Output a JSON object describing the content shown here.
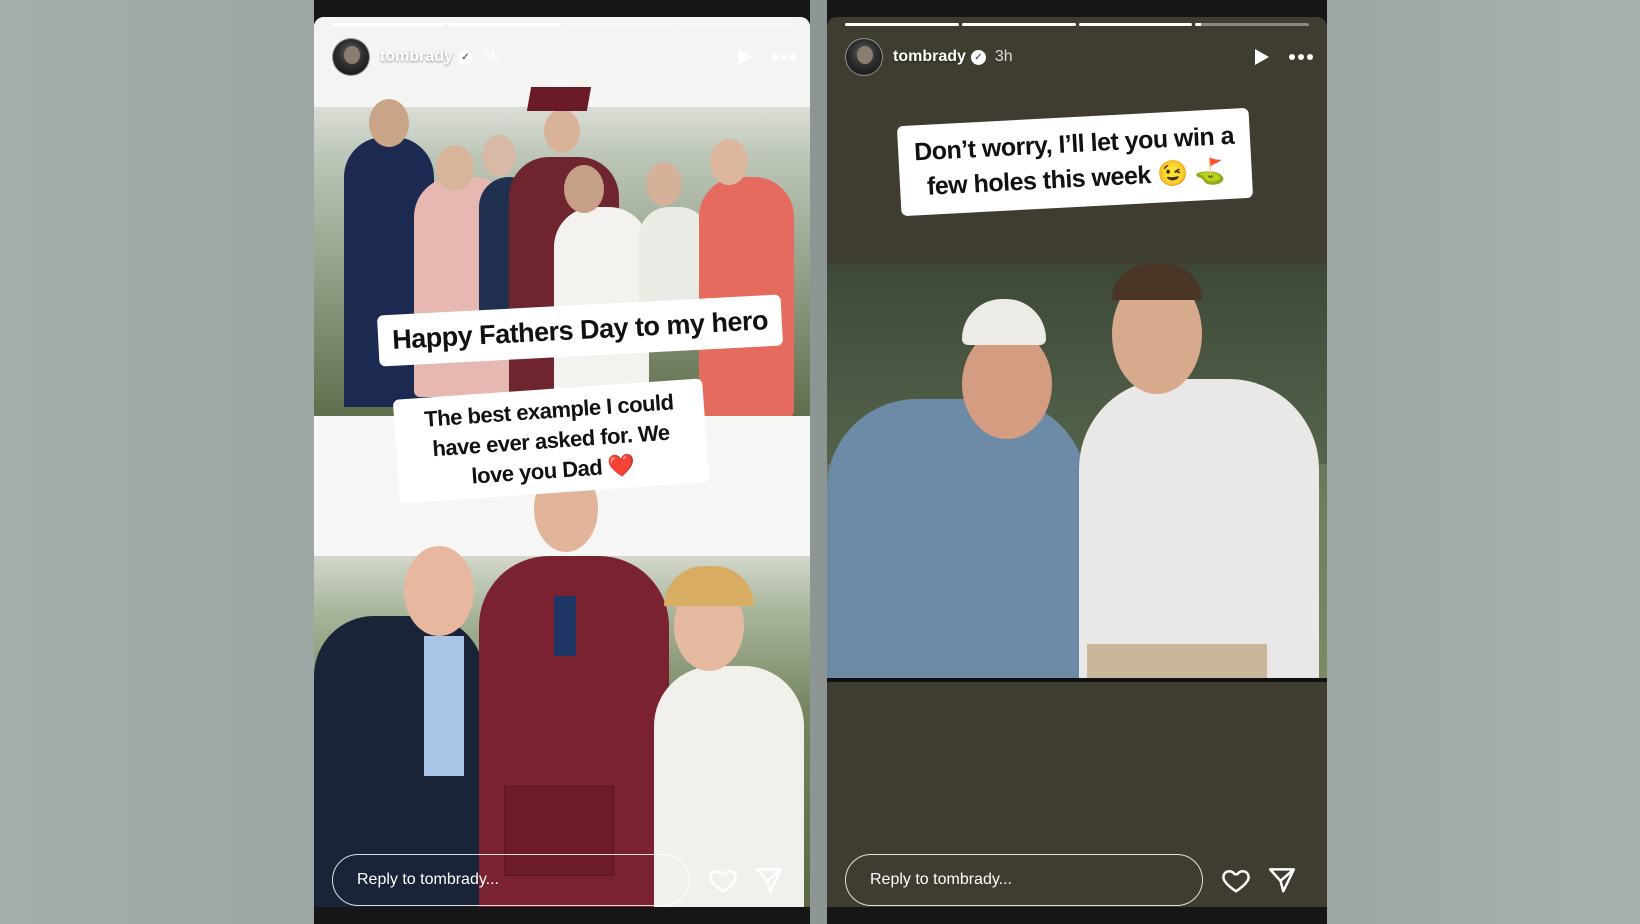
{
  "stories": [
    {
      "username": "tombrady",
      "verified_icon": "verified-badge-icon",
      "time": "3h",
      "progress": [
        1.0,
        1.0,
        0.0,
        0.0
      ],
      "captions": [
        "Happy Fathers Day to my hero",
        "The best example I could have ever asked for. We love you Dad ❤️"
      ],
      "reply_placeholder": "Reply to tombrady...",
      "icons": [
        "play-icon",
        "more-icon",
        "heart-icon",
        "send-icon"
      ]
    },
    {
      "username": "tombrady",
      "verified_icon": "verified-badge-icon",
      "time": "3h",
      "progress": [
        1.0,
        1.0,
        1.0,
        0.05
      ],
      "captions": [
        "Don’t worry, I’ll let you win a few holes this week 😉 ⛳"
      ],
      "reply_placeholder": "Reply to tombrady...",
      "icons": [
        "play-icon",
        "more-icon",
        "heart-icon",
        "send-icon"
      ]
    }
  ],
  "colors": {
    "story1_bg": "#d8d6d2",
    "story2_bg": "#3f3c32",
    "text_primary": "#ffffff",
    "caption_bg": "#ffffff"
  }
}
